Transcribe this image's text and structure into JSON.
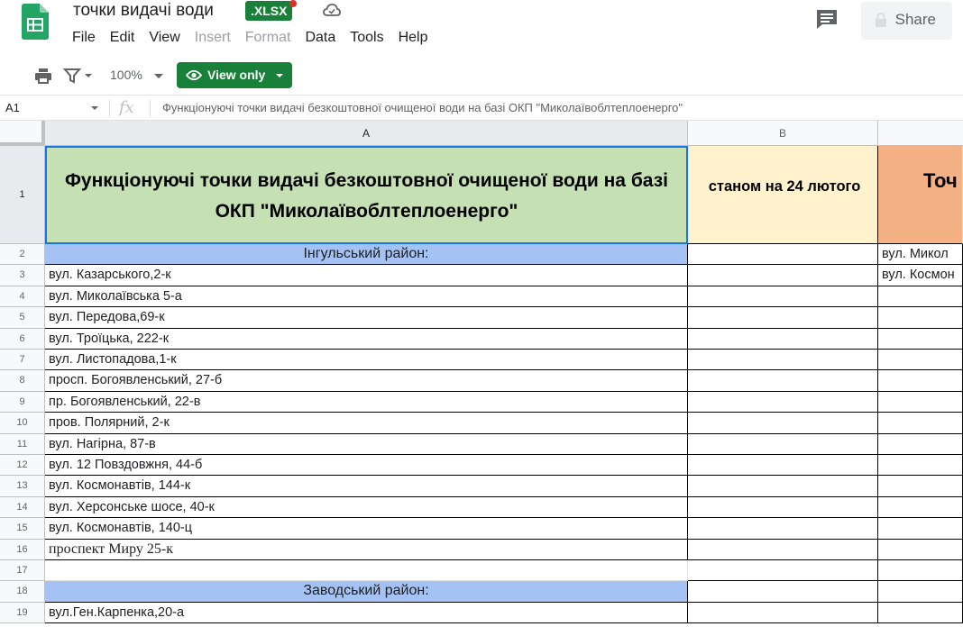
{
  "header": {
    "doc_title": "точки видачі води",
    "file_badge": ".XLSX",
    "share_label": "Share",
    "brand_color": "#188038"
  },
  "menu": {
    "items": [
      {
        "label": "File",
        "disabled": false
      },
      {
        "label": "Edit",
        "disabled": false
      },
      {
        "label": "View",
        "disabled": false
      },
      {
        "label": "Insert",
        "disabled": true
      },
      {
        "label": "Format",
        "disabled": true
      },
      {
        "label": "Data",
        "disabled": false
      },
      {
        "label": "Tools",
        "disabled": false
      },
      {
        "label": "Help",
        "disabled": false
      }
    ]
  },
  "toolbar": {
    "zoom": "100%",
    "view_only_label": "View only"
  },
  "formula_bar": {
    "cell_ref": "A1",
    "fx": "fx",
    "content": "Функціонуючі точки видачі безкоштовної очищеної води на базі ОКП \"Миколаївоблтеплоенерго\""
  },
  "sheet": {
    "columns": [
      "A",
      "B"
    ],
    "header_row": {
      "a": "Функціонуючі точки видачі безкоштовної очищеної води на базі ОКП \"Миколаївоблтеплоенерго\"",
      "b": "станом на 24 лютого",
      "c": "Точ"
    },
    "rows": [
      {
        "num": "2",
        "a": "Інгульський район:",
        "c": "вул. Микол"
      },
      {
        "num": "3",
        "a": "вул. Казарського,2-к",
        "c": "вул. Космон"
      },
      {
        "num": "4",
        "a": "вул. Миколаївська 5-а",
        "c": ""
      },
      {
        "num": "5",
        "a": "вул. Передова,69-к",
        "c": ""
      },
      {
        "num": "6",
        "a": "вул. Троїцька, 222-к",
        "c": ""
      },
      {
        "num": "7",
        "a": "вул. Листопадова,1-к",
        "c": ""
      },
      {
        "num": "8",
        "a": "просп. Богоявленський, 27-б",
        "c": ""
      },
      {
        "num": "9",
        "a": "пр. Богоявленський, 22-в",
        "c": ""
      },
      {
        "num": "10",
        "a": "пров. Полярний, 2-к",
        "c": ""
      },
      {
        "num": "11",
        "a": "вул. Нагірна, 87-в",
        "c": ""
      },
      {
        "num": "12",
        "a": "вул. 12 Повздовжня, 44-б",
        "c": ""
      },
      {
        "num": "13",
        "a": "вул. Космонавтів, 144-к",
        "c": ""
      },
      {
        "num": "14",
        "a": "вул. Херсонське шосе, 40-к",
        "c": ""
      },
      {
        "num": "15",
        "a": "вул. Космонавтів, 140-ц",
        "c": ""
      },
      {
        "num": "16",
        "a": "проспект Миру 25-к",
        "c": ""
      },
      {
        "num": "17",
        "a": "",
        "c": ""
      },
      {
        "num": "18",
        "a": "Заводський район:",
        "c": ""
      },
      {
        "num": "19",
        "a": "вул.Ген.Карпенка,20-а",
        "c": ""
      }
    ],
    "header_row_num": "1"
  }
}
